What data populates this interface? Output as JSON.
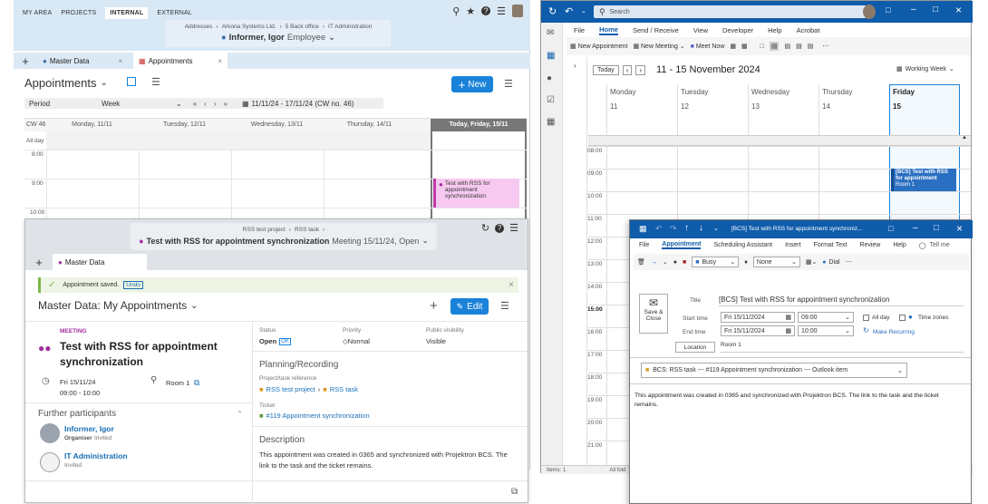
{
  "pj": {
    "nav": [
      "MY AREA",
      "PROJECTS",
      "INTERNAL",
      "EXTERNAL"
    ],
    "breadcrumb": [
      "Addresses",
      "Arkona Systems Ltd.",
      "5 Back office",
      "IT Administration"
    ],
    "user": "Informer, Igor",
    "user_role": "Employee",
    "tabs": [
      "Master Data",
      "Appointments"
    ],
    "page_title": "Appointments",
    "new_label": "New",
    "period_label": "Period",
    "period_value": "Week",
    "date_range": "11/11/24 - 17/11/24 (CW no. 46)",
    "cw": "CW 46",
    "days": [
      "Monday, 11/11",
      "Tuesday, 12/11",
      "Wednesday, 13/11",
      "Thursday, 14/11",
      "Today, Friday, 15/11"
    ],
    "allday": "All day",
    "hours": [
      "8:00",
      "9:00",
      "10:00"
    ],
    "event": "Test with RSS for appointment synchronization"
  },
  "md": {
    "crumb": [
      "RSS test project",
      "RSS task"
    ],
    "title": "Test with RSS for appointment synchronization",
    "title_meta": "Meeting 15/11/24, Open",
    "tab": "Master Data",
    "saved": "Appointment saved.",
    "undo": "Undo",
    "heading": "Master Data: My Appointments",
    "edit": "Edit",
    "type": "MEETING",
    "name": "Test with RSS for appointment synchronization",
    "date": "Fri 15/11/24",
    "time": "09:00 - 10:00",
    "room": "Room 1",
    "status_lbl": "Status",
    "status": "Open",
    "status_badge": "OK",
    "prio_lbl": "Priority",
    "prio": "Normal",
    "vis_lbl": "Public visibility",
    "vis": "Visible",
    "planning": "Planning/Recording",
    "ref_lbl": "Project/task reference",
    "ref_project": "RSS test project",
    "ref_task": "RSS task",
    "ticket_lbl": "Ticket",
    "ticket": "#119 Appointment synchronization",
    "desc_lbl": "Description",
    "desc": "This appointment was created in 0365 and synchronized with Projektron BCS. The link to the task and the ticket remains.",
    "participants_lbl": "Further participants",
    "p1": "Informer, Igor",
    "p1_role": "Organiser",
    "p1_status": "Invited",
    "p2": "IT Administration",
    "p2_status": "Invited"
  },
  "ol": {
    "search": "Search",
    "menu": [
      "File",
      "Home",
      "Send / Receive",
      "View",
      "Developer",
      "Help",
      "Acrobat"
    ],
    "new_appt": "New Appointment",
    "new_meeting": "New Meeting",
    "meet_now": "Meet Now",
    "today": "Today",
    "range": "11 - 15 November 2024",
    "view": "Working Week",
    "days": [
      "Monday",
      "Tuesday",
      "Wednesday",
      "Thursday",
      "Friday"
    ],
    "dates": [
      "11",
      "12",
      "13",
      "14",
      "15"
    ],
    "hours": [
      "08:00",
      "09:00",
      "10:00",
      "11:00",
      "12:00",
      "13:00",
      "14:00",
      "15:00",
      "16:00",
      "17:00",
      "18:00",
      "19:00",
      "20:00",
      "21:00"
    ],
    "event": "[BCS] Test with RSS for appointment",
    "event_room": "Room 1",
    "items": "Items: 1",
    "folder": "All fold"
  },
  "ap": {
    "wtitle": "[BCS] Test with RSS for appointment synchroniz...",
    "menu": [
      "File",
      "Appointment",
      "Scheduling Assistant",
      "Insert",
      "Format Text",
      "Review",
      "Help"
    ],
    "tellme": "Tell me",
    "busy": "Busy",
    "none": "None",
    "dial": "Dial",
    "save": "Save &",
    "close": "Close",
    "title_lbl": "Title",
    "title": "[BCS] Test with RSS for appointment synchronization",
    "start_lbl": "Start time",
    "start_date": "Fri 15/11/2024",
    "start_time": "09:00",
    "end_lbl": "End time",
    "end_date": "Fri 15/11/2024",
    "end_time": "10:00",
    "allday": "All day",
    "tz": "Time zones",
    "recur": "Make Recurring",
    "loc_lbl": "Location",
    "loc": "Room 1",
    "bcs": "BCS: RSS task --- #119 Appointment synchronization --- Outlook item",
    "body": "This appointment was created in 0365 and synchronized with Projektron BCS. The link to the task and the ticket remains."
  }
}
